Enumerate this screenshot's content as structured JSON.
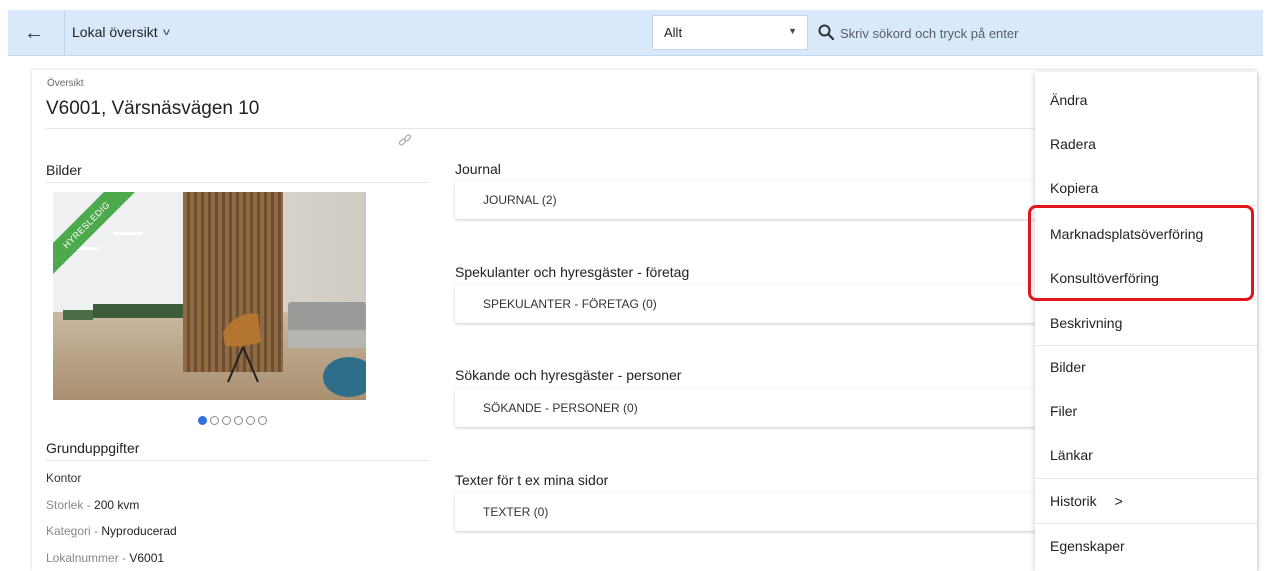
{
  "header": {
    "back_icon": "arrow-left-icon",
    "breadcrumb": "Lokal översikt",
    "scope_select": "Allt",
    "search_placeholder": "Skriv sökord och tryck på enter"
  },
  "overview": {
    "label": "Översikt",
    "title": "V6001, Värsnäsvägen 10"
  },
  "images": {
    "title": "Bilder",
    "ribbon": "HYRESLEDIG",
    "slide_count": 6,
    "active_slide": 1
  },
  "basic": {
    "title": "Grunduppgifter",
    "type": "Kontor",
    "size_label": "Storlek - ",
    "size_value": "200 kvm",
    "category_label": "Kategori - ",
    "category_value": "Nyproducerad",
    "number_label": "Lokalnummer - ",
    "number_value": "V6001"
  },
  "sections": [
    {
      "title": "Journal",
      "box": "JOURNAL (2)"
    },
    {
      "title": "Spekulanter och hyresgäster - företag",
      "box": "SPEKULANTER - FÖRETAG  (0)"
    },
    {
      "title": "Sökande och hyresgäster - personer",
      "box": "SÖKANDE - PERSONER  (0)"
    },
    {
      "title": "Texter för t ex mina sidor",
      "box": "TEXTER  (0)"
    }
  ],
  "menu": {
    "items": [
      "Ändra",
      "Radera",
      "Kopiera",
      "Marknadsplatsöverföring",
      "Konsultöverföring",
      "Beskrivning",
      "Bilder",
      "Filer",
      "Länkar",
      "Historik",
      "Egenskaper"
    ],
    "historik_arrow": ">",
    "highlight_color": "#e0161d"
  },
  "colors": {
    "topbar": "#d9e8fb",
    "ribbon": "#4caa4c",
    "active_dot": "#2f6fe0"
  }
}
